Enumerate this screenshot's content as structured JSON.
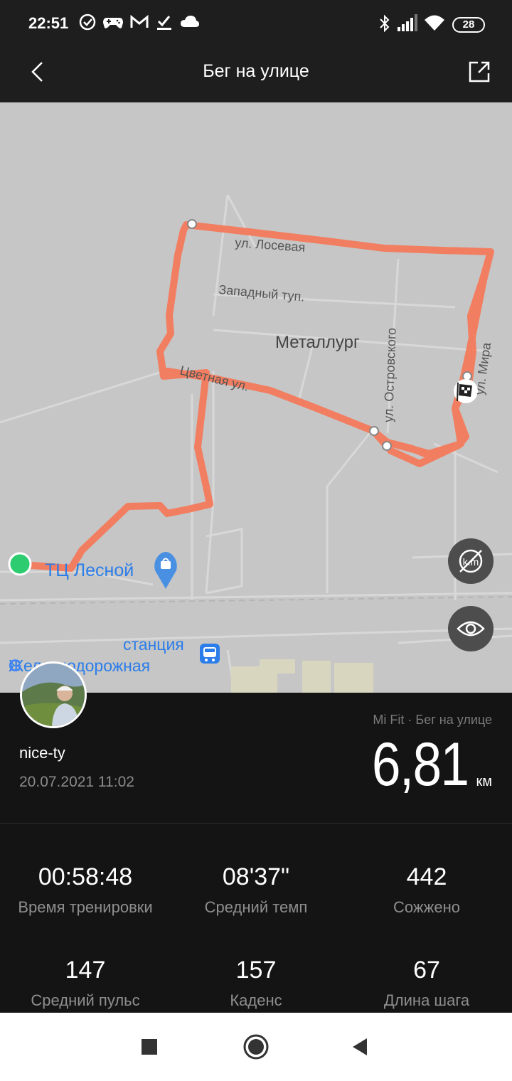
{
  "status_bar": {
    "time": "22:51",
    "icons": [
      "check-circle-icon",
      "gamepad-icon",
      "gmail-icon",
      "checklist-icon",
      "cloud-icon",
      "bluetooth-icon",
      "signal-icon",
      "wifi-icon",
      "battery-icon"
    ],
    "battery": "28"
  },
  "header": {
    "title": "Бег на улице",
    "back_icon": "chevron-left-icon",
    "share_icon": "share-icon"
  },
  "map": {
    "labels": {
      "street_loseva": "ул. Лосевая",
      "street_zapadny": "Западный туп.",
      "district": "Металлург",
      "street_ostrovskogo": "ул. Островского",
      "street_mira": "ул. Мира",
      "street_tsvetnaya": "Цветная ул.",
      "mall": "ТЦ Лесной",
      "station_line1": "станция",
      "station_line2": "Железнодорожная"
    },
    "route_color": "#f47a5c",
    "start_color": "#2ecc71"
  },
  "workout": {
    "user": "nice-ty",
    "date": "20.07.2021 11:02",
    "source": "Mi Fit · Бег на улице",
    "distance": "6,81",
    "distance_unit": "км"
  },
  "stats": [
    {
      "value": "00:58:48",
      "label": "Время тренировки"
    },
    {
      "value": "08'37\"",
      "label": "Средний темп"
    },
    {
      "value": "442",
      "label": "Сожжено"
    },
    {
      "value": "147",
      "label": "Средний пульс"
    },
    {
      "value": "157",
      "label": "Каденс"
    },
    {
      "value": "67",
      "label": "Длина шага"
    }
  ],
  "nav": {
    "icons": [
      "square-recents-icon",
      "circle-home-icon",
      "triangle-back-icon"
    ]
  }
}
